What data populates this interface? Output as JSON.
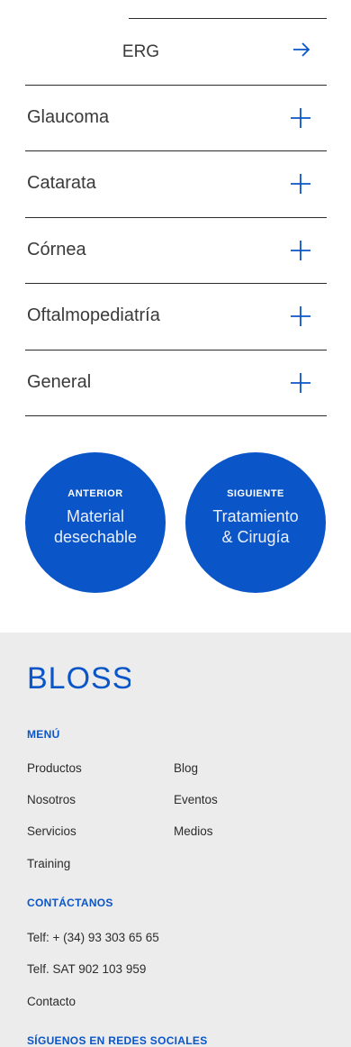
{
  "submenu": {
    "label": "ERG",
    "icon": "arrow-right-icon"
  },
  "accordion": [
    {
      "label": "Glaucoma",
      "icon": "plus-icon"
    },
    {
      "label": "Catarata",
      "icon": "plus-icon"
    },
    {
      "label": "Córnea",
      "icon": "plus-icon"
    },
    {
      "label": "Oftalmopediatría",
      "icon": "plus-icon"
    },
    {
      "label": "General",
      "icon": "plus-icon"
    }
  ],
  "nav": {
    "previous": {
      "kicker": "ANTERIOR",
      "line1": "Material",
      "line2": "desechable"
    },
    "next": {
      "kicker": "SIGUIENTE",
      "line1": "Tratamiento",
      "line2": "& Cirugía"
    }
  },
  "footer": {
    "brand": "BLOSS",
    "menu_heading": "MENÚ",
    "menu_col1": [
      "Productos",
      "Nosotros",
      "Servicios",
      "Training"
    ],
    "menu_col2": [
      "Blog",
      "Eventos",
      "Medios"
    ],
    "contact_heading": "CONTÁCTANOS",
    "contact": [
      "Telf: + (34) 93 303 65 65",
      "Telf. SAT 902 103 959",
      "Contacto"
    ],
    "social_heading": "SÍGUENOS EN REDES SOCIALES"
  },
  "colors": {
    "accent": "#0a55c8",
    "text": "#2b2b2b",
    "footer_bg": "#ececec"
  }
}
